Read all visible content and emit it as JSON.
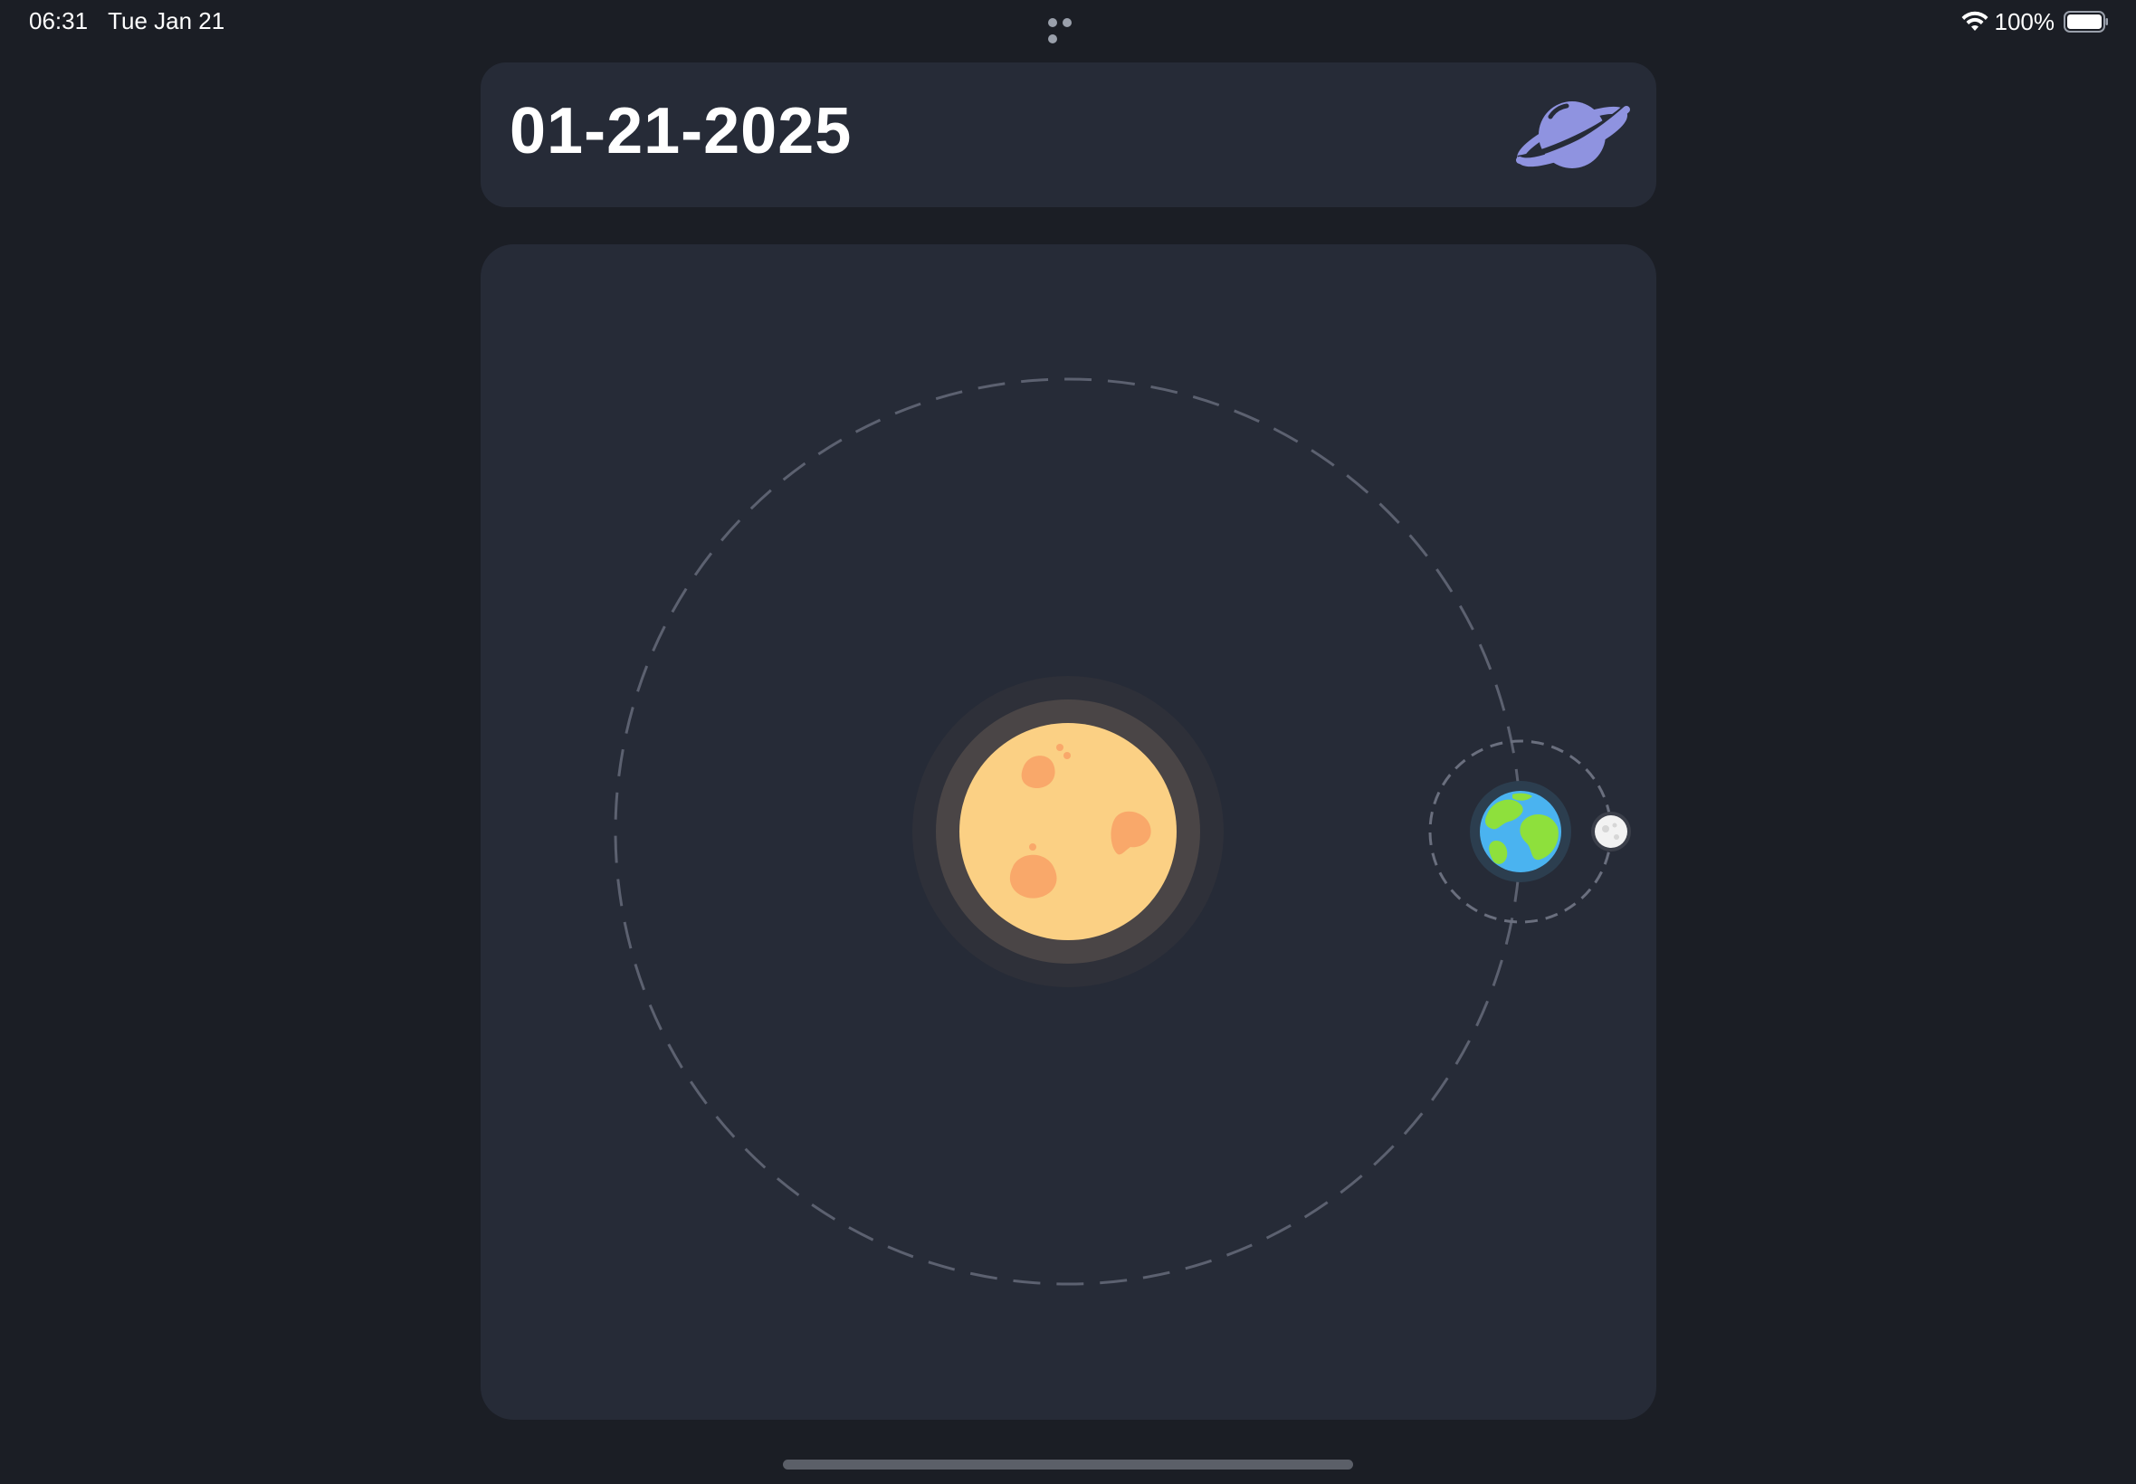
{
  "status_bar": {
    "time": "06:31",
    "date": "Tue Jan 21",
    "battery_percent": "100%",
    "battery_level": 1.0,
    "icons": [
      "multitasking-dots-icon",
      "wifi-icon",
      "battery-icon"
    ]
  },
  "header": {
    "date": "01-21-2025",
    "icon": "saturn-planet-icon"
  },
  "orbit_view": {
    "bodies": [
      "sun",
      "earth",
      "moon"
    ]
  },
  "colors": {
    "background": "#1b1e25",
    "card": "#262b37",
    "sun": "#fbd084",
    "sun_spots": "#f9a86a",
    "earth_ocean": "#4ab3f0",
    "earth_land": "#8ee03c",
    "moon": "#f2f2f2",
    "planet_icon": "#8f93e0",
    "orbit_line": "#5c6170"
  }
}
